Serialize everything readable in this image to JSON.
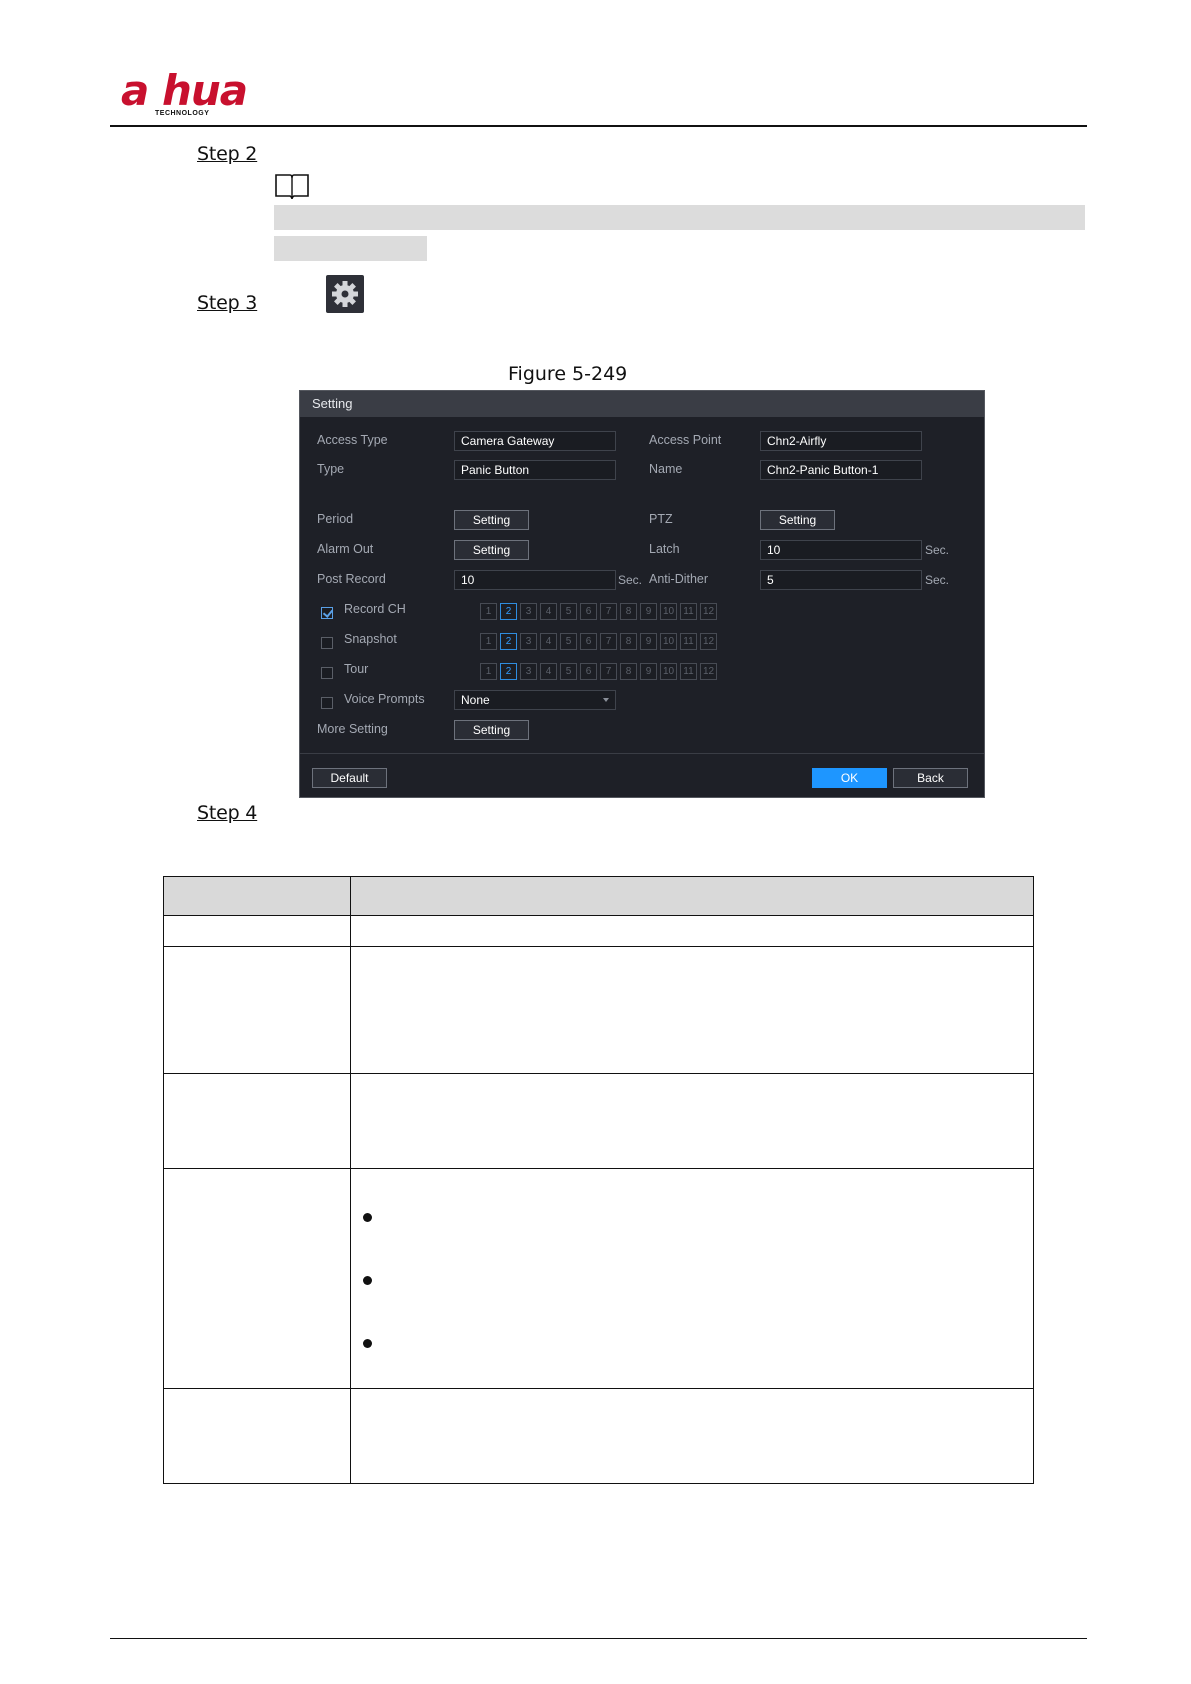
{
  "header": {
    "logo_text": "a hua",
    "logo_sub": "TECHNOLOGY"
  },
  "steps": {
    "step2": "Step 2",
    "step3": "Step 3",
    "step4": "Step 4"
  },
  "figure": {
    "caption": "Figure 5-249"
  },
  "dialog": {
    "title": "Setting",
    "access_type_label": "Access Type",
    "access_type_value": "Camera Gateway",
    "access_point_label": "Access Point",
    "access_point_value": "Chn2-Airfly",
    "type_label": "Type",
    "type_value": "Panic Button",
    "name_label": "Name",
    "name_value": "Chn2-Panic Button-1",
    "period_label": "Period",
    "period_button": "Setting",
    "ptz_label": "PTZ",
    "ptz_button": "Setting",
    "alarm_out_label": "Alarm Out",
    "alarm_out_button": "Setting",
    "latch_label": "Latch",
    "latch_value": "10",
    "latch_unit": "Sec.",
    "post_record_label": "Post Record",
    "post_record_value": "10",
    "post_record_unit": "Sec.",
    "anti_dither_label": "Anti-Dither",
    "anti_dither_value": "5",
    "anti_dither_unit": "Sec.",
    "record_ch_label": "Record CH",
    "snapshot_label": "Snapshot",
    "tour_label": "Tour",
    "voice_prompts_label": "Voice Prompts",
    "voice_prompts_value": "None",
    "more_setting_label": "More Setting",
    "more_setting_button": "Setting",
    "default_button": "Default",
    "ok_button": "OK",
    "back_button": "Back",
    "channels": [
      "1",
      "2",
      "3",
      "4",
      "5",
      "6",
      "7",
      "8",
      "9",
      "10",
      "11",
      "12"
    ],
    "selected_channel": "2"
  },
  "colors": {
    "accent": "#1e96ff",
    "brand": "#c8102e",
    "dialog_bg": "#1e2027"
  }
}
